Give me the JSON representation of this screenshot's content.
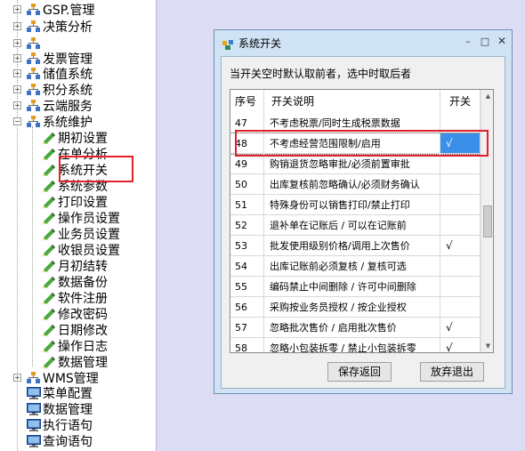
{
  "tree": {
    "items": [
      {
        "label": "GSP.管理",
        "level": 0,
        "icon": "folder-tree-icon",
        "expanded": false
      },
      {
        "label": "决策分析",
        "level": 0,
        "icon": "folder-tree-icon",
        "expanded": false
      },
      {
        "label": "",
        "level": 0,
        "icon": "folder-tree-icon",
        "expanded": false
      },
      {
        "label": "发票管理",
        "level": 0,
        "icon": "folder-tree-icon",
        "expanded": false
      },
      {
        "label": "储值系统",
        "level": 0,
        "icon": "folder-tree-icon",
        "expanded": false
      },
      {
        "label": "积分系统",
        "level": 0,
        "icon": "folder-tree-icon",
        "expanded": false
      },
      {
        "label": "云端服务",
        "level": 0,
        "icon": "folder-tree-icon",
        "expanded": false
      },
      {
        "label": "系统维护",
        "level": 0,
        "icon": "folder-tree-icon",
        "expanded": true
      },
      {
        "label": "期初设置",
        "level": 1,
        "icon": "pencil-icon"
      },
      {
        "label": "在单分析",
        "level": 1,
        "icon": "pencil-icon"
      },
      {
        "label": "系统开关",
        "level": 1,
        "icon": "pencil-icon"
      },
      {
        "label": "系统参数",
        "level": 1,
        "icon": "pencil-icon"
      },
      {
        "label": "打印设置",
        "level": 1,
        "icon": "pencil-icon"
      },
      {
        "label": "操作员设置",
        "level": 1,
        "icon": "pencil-icon"
      },
      {
        "label": "业务员设置",
        "level": 1,
        "icon": "pencil-icon"
      },
      {
        "label": "收银员设置",
        "level": 1,
        "icon": "pencil-icon"
      },
      {
        "label": "月初结转",
        "level": 1,
        "icon": "pencil-icon"
      },
      {
        "label": "数据备份",
        "level": 1,
        "icon": "pencil-icon"
      },
      {
        "label": "软件注册",
        "level": 1,
        "icon": "pencil-icon"
      },
      {
        "label": "修改密码",
        "level": 1,
        "icon": "pencil-icon"
      },
      {
        "label": "日期修改",
        "level": 1,
        "icon": "pencil-icon"
      },
      {
        "label": "操作日志",
        "level": 1,
        "icon": "pencil-icon"
      },
      {
        "label": "数据管理",
        "level": 1,
        "icon": "pencil-icon"
      },
      {
        "label": "WMS管理",
        "level": 0,
        "icon": "folder-tree-icon",
        "expanded": false
      },
      {
        "label": "菜单配置",
        "level": 0,
        "icon": "monitor-icon"
      },
      {
        "label": "数据管理",
        "level": 0,
        "icon": "monitor-icon"
      },
      {
        "label": "执行语句",
        "level": 0,
        "icon": "monitor-icon"
      },
      {
        "label": "查询语句",
        "level": 0,
        "icon": "monitor-icon"
      }
    ]
  },
  "dialog": {
    "title": "系统开关",
    "hint": "当开关空时默认取前者，选中时取后者",
    "columns": {
      "no": "序号",
      "desc": "开关说明",
      "switch": "开关"
    },
    "rows": [
      {
        "no": "47",
        "desc": "不考虑税票/同时生成税票数据",
        "on": false
      },
      {
        "no": "48",
        "desc": "不考虑经营范围限制/启用",
        "on": true
      },
      {
        "no": "49",
        "desc": "购销退货忽略审批/必须前置审批",
        "on": false
      },
      {
        "no": "50",
        "desc": "出库复核前忽略确认/必须财务确认",
        "on": false
      },
      {
        "no": "51",
        "desc": "特殊身份可以销售打印/禁止打印",
        "on": false
      },
      {
        "no": "52",
        "desc": "退补单在记账后 / 可以在记账前",
        "on": false
      },
      {
        "no": "53",
        "desc": "批发使用级别价格/调用上次售价",
        "on": true
      },
      {
        "no": "54",
        "desc": "出库记账前必须复核 / 复核可选",
        "on": false
      },
      {
        "no": "55",
        "desc": "编码禁止中间删除 / 许可中间删除",
        "on": false
      },
      {
        "no": "56",
        "desc": "采购按业务员授权 / 按企业授权",
        "on": false
      },
      {
        "no": "57",
        "desc": "忽略批次售价 / 启用批次售价",
        "on": true
      },
      {
        "no": "58",
        "desc": "忽略小包装拆零 / 禁止小包装拆零",
        "on": true
      }
    ],
    "selected_row": "48",
    "check_mark": "√",
    "scroll_up": "▲",
    "scroll_down": "▼",
    "save_label": "保存返回",
    "cancel_label": "放弃退出",
    "minimize": "–",
    "maximize": "□",
    "close": "✕"
  },
  "colors": {
    "highlight": "#3c8fe8",
    "annotation": "#e0202a"
  }
}
